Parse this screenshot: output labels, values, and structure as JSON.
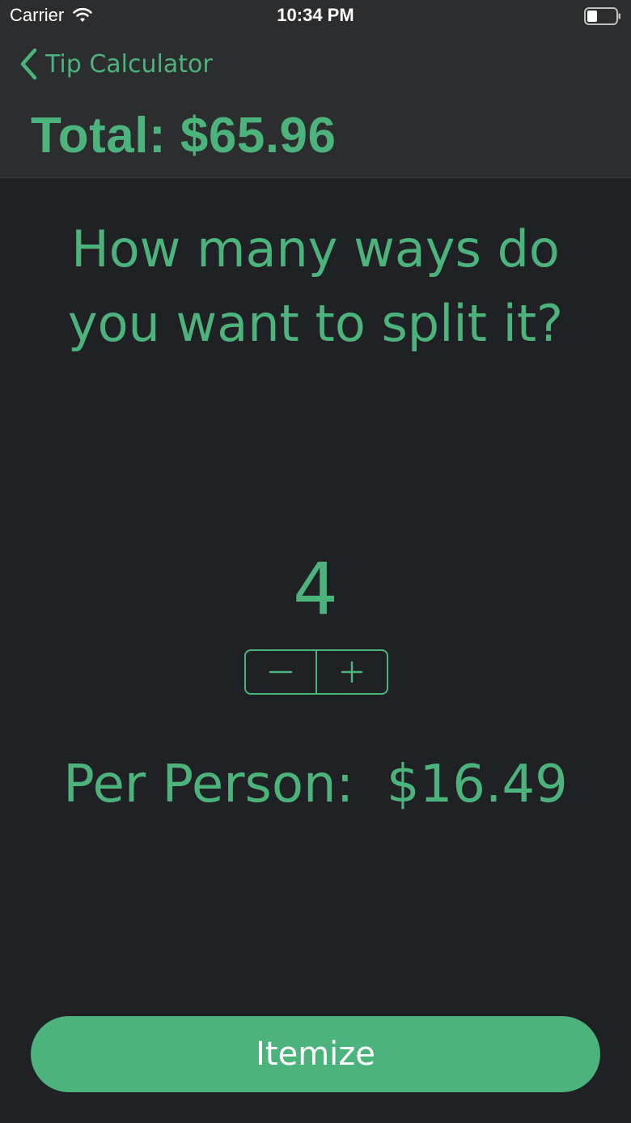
{
  "status_bar": {
    "carrier": "Carrier",
    "time": "10:34 PM",
    "wifi_icon": "wifi-icon",
    "battery_icon": "battery-icon"
  },
  "nav": {
    "back_label": "Tip Calculator",
    "title": "Total: $65.96"
  },
  "main": {
    "question": "How many ways do you want to split it?",
    "split_count": "4",
    "stepper": {
      "minus_icon": "minus-icon",
      "plus_icon": "plus-icon"
    },
    "per_person": "Per Person:  $16.49"
  },
  "actions": {
    "itemize_label": "Itemize"
  },
  "colors": {
    "accent": "#4cb37c",
    "background": "#202124",
    "header_background": "#2c2d2f"
  }
}
